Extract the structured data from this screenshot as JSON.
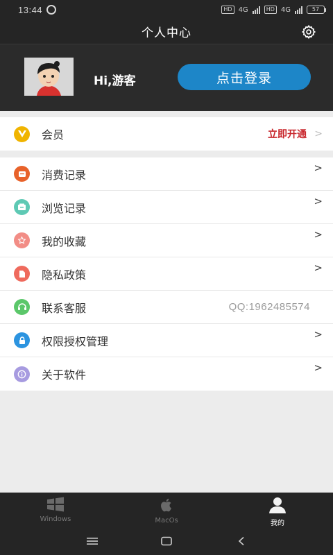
{
  "status_bar": {
    "time": "13:44",
    "hd1": "HD",
    "hd2": "HD",
    "network1": "4G",
    "network2": "4G",
    "battery": "57"
  },
  "header": {
    "title": "个人中心",
    "settings_icon": "gear-icon"
  },
  "profile": {
    "greeting": "Hi,游客",
    "login_label": "点击登录"
  },
  "member": {
    "label": "会员",
    "cta": "立即开通",
    "icon": "vip-icon",
    "icon_color": "#f0b400"
  },
  "menu": [
    {
      "label": "消费记录",
      "icon": "receipt-icon",
      "color": "#e8622a",
      "value": "",
      "chevron": ">"
    },
    {
      "label": "浏览记录",
      "icon": "history-icon",
      "color": "#5ec9b4",
      "value": "",
      "chevron": ">"
    },
    {
      "label": "我的收藏",
      "icon": "star-icon",
      "color": "#f28d86",
      "value": "",
      "chevron": ">"
    },
    {
      "label": "隐私政策",
      "icon": "document-icon",
      "color": "#ef6a5d",
      "value": "",
      "chevron": ">"
    },
    {
      "label": "联系客服",
      "icon": "headset-icon",
      "color": "#5bc76a",
      "value": "QQ:1962485574",
      "chevron": ""
    },
    {
      "label": "权限授权管理",
      "icon": "lock-icon",
      "color": "#2c94e0",
      "value": "",
      "chevron": ">"
    },
    {
      "label": "关于软件",
      "icon": "info-icon",
      "color": "#a79be0",
      "value": "",
      "chevron": ">"
    }
  ],
  "tabs": [
    {
      "label": "Windows",
      "icon": "windows-icon",
      "active": false
    },
    {
      "label": "MacOs",
      "icon": "apple-icon",
      "active": false
    },
    {
      "label": "我的",
      "icon": "user-icon",
      "active": true
    }
  ],
  "colors": {
    "accent": "#1d86c8",
    "header_bg": "#2b2b2b",
    "cta_red": "#c8252b"
  }
}
